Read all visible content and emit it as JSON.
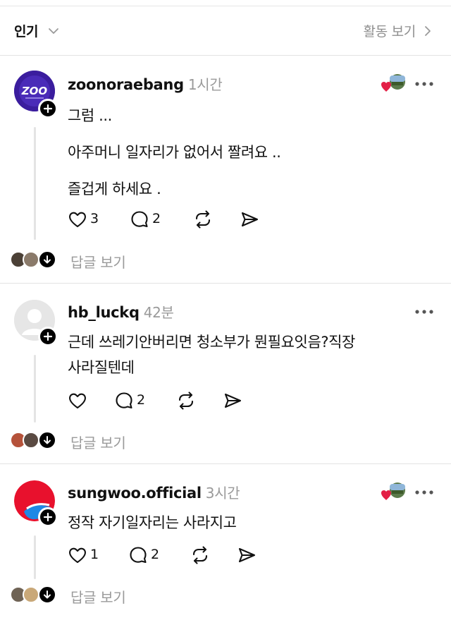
{
  "filter": {
    "sort_label": "인기",
    "activity_label": "활동 보기"
  },
  "posts": [
    {
      "username": "zoonoraebang",
      "time": "1시간",
      "avatar_text": "ZOO",
      "avatar_color": "#3a1f9c",
      "lines": [
        "그럼 ...",
        "아주머니 일자리가 없어서 짤려요 ..",
        "즐겁게 하세요 ."
      ],
      "likes": "3",
      "replies": "2",
      "view_replies": "답글 보기"
    },
    {
      "username": "hb_luckq",
      "time": "42분",
      "lines": [
        "근데 쓰레기안버리면 청소부가 뭔필요잇음?직장",
        "사라질텐데"
      ],
      "likes": "",
      "replies": "2",
      "view_replies": "답글 보기"
    },
    {
      "username": "sungwoo.official",
      "time": "3시간",
      "avatar_color": "#e8112d",
      "lines": [
        "정작 자기일자리는 사라지고"
      ],
      "likes": "1",
      "replies": "2",
      "view_replies": "답글 보기"
    }
  ],
  "icons": {
    "more": "more-horizontal-icon",
    "like": "heart-outline-icon",
    "reply": "comment-bubble-icon",
    "repost": "repost-arrows-icon",
    "share": "send-arrow-icon",
    "follow": "plus-icon",
    "expand": "chevron-down-icon"
  }
}
